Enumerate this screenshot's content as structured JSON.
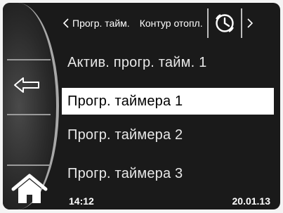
{
  "header": {
    "back_label": "Прогр. тайм.",
    "current_label": "Контур отопл."
  },
  "menu": {
    "items": [
      {
        "label": "Актив. прогр. тайм. 1",
        "selected": false
      },
      {
        "label": "Прогр. таймера  1",
        "selected": true
      },
      {
        "label": "Прогр. таймера  2",
        "selected": false
      },
      {
        "label": "Прогр. таймера  3",
        "selected": false
      }
    ]
  },
  "status": {
    "time": "14:12",
    "date": "20.01.13"
  },
  "icons": {
    "back": "arrow-left-icon",
    "home": "home-icon",
    "clock": "clock-icon",
    "header_back": "chevron-left-icon",
    "next": "chevron-right-icon"
  },
  "colors": {
    "background": "#1a1a1a",
    "highlight": "#ffffff",
    "text": "#e8e8e8"
  }
}
